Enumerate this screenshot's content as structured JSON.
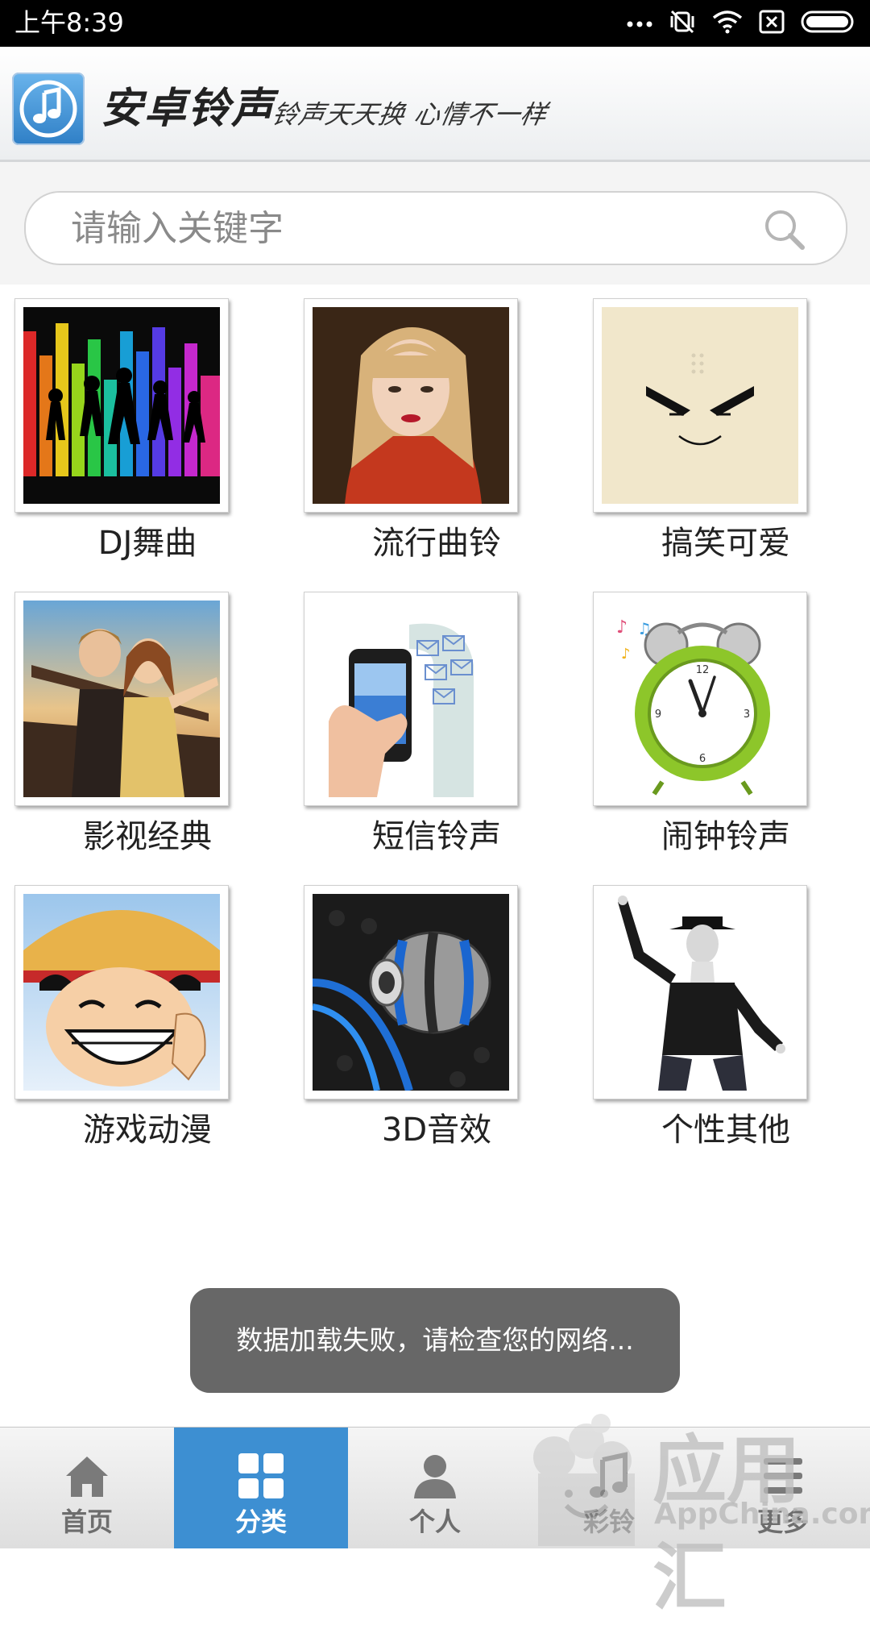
{
  "status_bar": {
    "time": "上午8:39"
  },
  "header": {
    "app_title": "安卓铃声",
    "slogan": "铃声天天换 心情不一样"
  },
  "search": {
    "placeholder": "请输入关键字"
  },
  "categories": [
    {
      "label": "DJ舞曲",
      "icon": "dj-dance-image"
    },
    {
      "label": "流行曲铃",
      "icon": "pop-singer-image"
    },
    {
      "label": "搞笑可爱",
      "icon": "funny-face-image"
    },
    {
      "label": "影视经典",
      "icon": "movie-classic-image"
    },
    {
      "label": "短信铃声",
      "icon": "sms-phone-image"
    },
    {
      "label": "闹钟铃声",
      "icon": "alarm-clock-image"
    },
    {
      "label": "游戏动漫",
      "icon": "anime-character-image"
    },
    {
      "label": "3D音效",
      "icon": "3d-sphere-image"
    },
    {
      "label": "个性其他",
      "icon": "dancer-image"
    }
  ],
  "toast": {
    "message": "数据加载失败，请检查您的网络..."
  },
  "tabbar": {
    "tabs": [
      {
        "label": "首页",
        "icon": "home-icon",
        "active": false
      },
      {
        "label": "分类",
        "icon": "grid-icon",
        "active": true
      },
      {
        "label": "个人",
        "icon": "person-icon",
        "active": false
      },
      {
        "label": "彩铃",
        "icon": "music-note-icon",
        "active": false
      },
      {
        "label": "更多",
        "icon": "more-icon",
        "active": false
      }
    ]
  },
  "watermark": {
    "text": "应用汇",
    "subtext": "AppChina.com"
  },
  "colors": {
    "accent": "#3d8fd2",
    "toast_bg": "#676767",
    "status_bar": "#000000"
  }
}
